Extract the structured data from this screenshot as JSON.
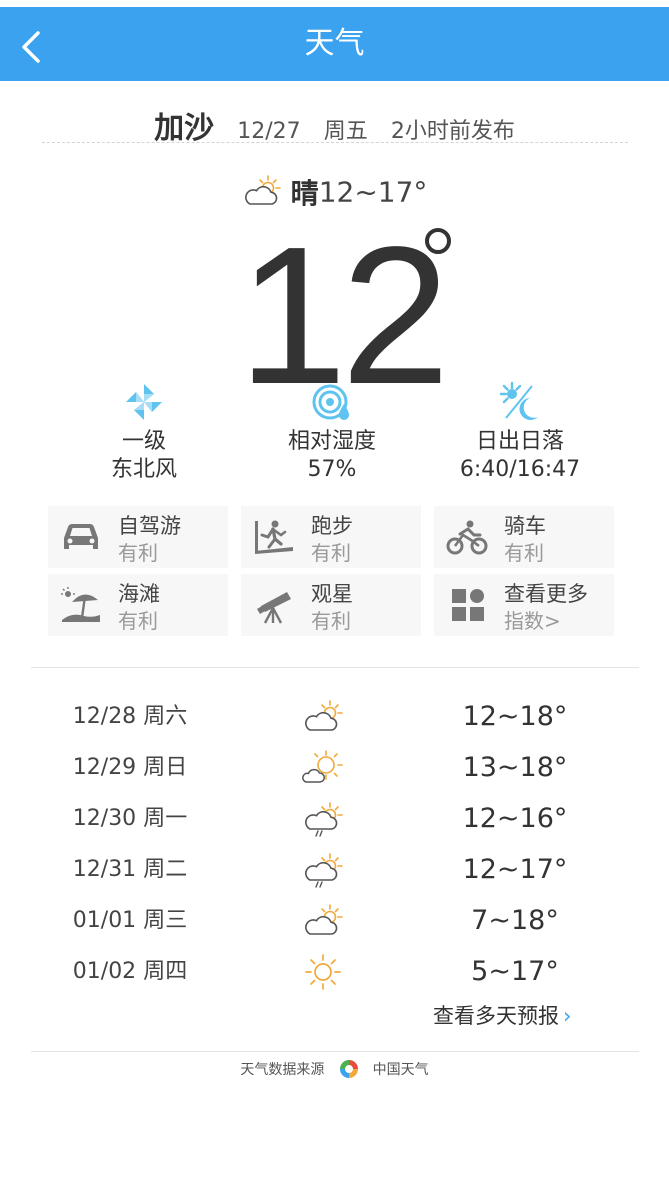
{
  "header": {
    "title": "天气",
    "back_icon": "chevron-left-icon"
  },
  "location": {
    "city": "加沙",
    "date": "12/27",
    "weekday": "周五",
    "published": "2小时前发布"
  },
  "today": {
    "condition": "晴",
    "range": "12~17°",
    "condition_icon": "partly-cloudy-icon",
    "current_temp": "12"
  },
  "stats": [
    {
      "icon": "pinwheel-wind-icon",
      "line1": "一级",
      "line2": "东北风"
    },
    {
      "icon": "humidity-gauge-icon",
      "line1": "相对湿度",
      "line2": "57%"
    },
    {
      "icon": "sunrise-sunset-icon",
      "line1": "日出日落",
      "line2": "6:40/16:47"
    }
  ],
  "indices": [
    {
      "icon": "car-icon",
      "name": "自驾游",
      "value": "有利"
    },
    {
      "icon": "treadmill-runner-icon",
      "name": "跑步",
      "value": "有利"
    },
    {
      "icon": "cyclist-icon",
      "name": "骑车",
      "value": "有利"
    },
    {
      "icon": "beach-umbrella-icon",
      "name": "海滩",
      "value": "有利"
    },
    {
      "icon": "telescope-icon",
      "name": "观星",
      "value": "有利"
    },
    {
      "icon": "grid-more-icon",
      "name": "查看更多",
      "value": "指数>"
    }
  ],
  "forecast": [
    {
      "date": "12/28",
      "weekday": "周六",
      "icon": "partly-cloudy-icon",
      "range": "12~18°"
    },
    {
      "date": "12/29",
      "weekday": "周日",
      "icon": "sun-cloud-icon",
      "range": "13~18°"
    },
    {
      "date": "12/30",
      "weekday": "周一",
      "icon": "cloud-rain-sun-icon",
      "range": "12~16°"
    },
    {
      "date": "12/31",
      "weekday": "周二",
      "icon": "cloud-rain-sun-icon",
      "range": "12~17°"
    },
    {
      "date": "01/01",
      "weekday": "周三",
      "icon": "partly-cloudy-icon",
      "range": "7~18°"
    },
    {
      "date": "01/02",
      "weekday": "周四",
      "icon": "sunny-icon",
      "range": "5~17°"
    }
  ],
  "more_forecast": {
    "label": "查看多天预报",
    "arrow": "›"
  },
  "footer": {
    "source_label": "天气数据来源",
    "source_name": "中国天气"
  },
  "colors": {
    "header_bg": "#3aa2ee",
    "sun_orange": "#f2a93b",
    "stat_icon_blue": "#5ec3ee",
    "index_icon_gray": "#777777"
  }
}
